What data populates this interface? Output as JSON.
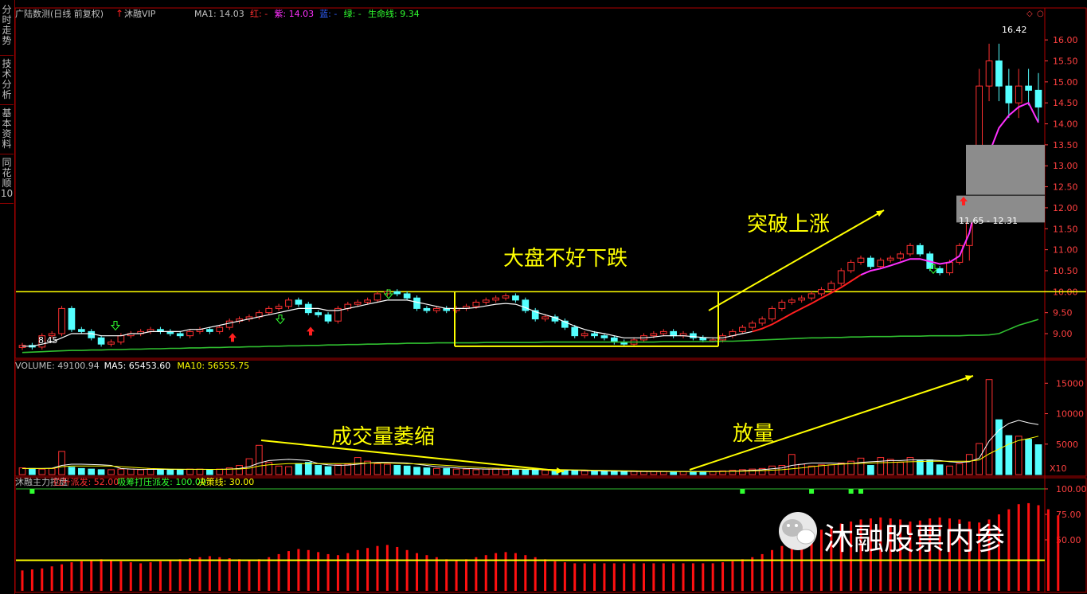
{
  "sidebar": {
    "tabs": [
      {
        "label": "分时走势",
        "active": false
      },
      {
        "label": "技术分析",
        "active": true
      },
      {
        "label": "基本资料",
        "active": false
      },
      {
        "label": "同花顺10",
        "active": false
      }
    ]
  },
  "header": {
    "title": "广陆数测(日线 前复权)",
    "badge": "沐融VIP",
    "legend": [
      {
        "text": "MA1: 14.03",
        "color": "#c0c0c0"
      },
      {
        "text": "红: -",
        "color": "#ff3030"
      },
      {
        "text": "紫: 14.03",
        "color": "#ff30ff"
      },
      {
        "text": "蓝: -",
        "color": "#3060ff"
      },
      {
        "text": "绿: -",
        "color": "#30ff30"
      },
      {
        "text": "生命线: 9.34",
        "color": "#30ff30"
      }
    ]
  },
  "volume_header": [
    {
      "text": "VOLUME: 49100.94",
      "color": "#c0c0c0"
    },
    {
      "text": "MA5: 65453.60",
      "color": "#ffffff"
    },
    {
      "text": "MA10: 56555.75",
      "color": "#ffff00"
    }
  ],
  "indicator_header": [
    {
      "text": "沐融主力控盘",
      "color": "#c0c0c0"
    },
    {
      "text": "拉升派发: 52.00",
      "color": "#ff3030"
    },
    {
      "text": "吸筹打压派发: 100.00",
      "color": "#30ff30"
    },
    {
      "text": "决策线: 30.00",
      "color": "#ffff00"
    }
  ],
  "annotations": {
    "weak_market": "大盘不好下跌",
    "breakout": "突破上涨",
    "volume_shrink": "成交量萎缩",
    "volume_expand": "放量"
  },
  "watermark": "沐融股票内参",
  "price_labels": {
    "high": "16.42",
    "low": "8.45",
    "range": "11.65 - 12.31"
  },
  "volume_unit": "X10",
  "colors": {
    "up": "#ff3030",
    "down": "#54ffff",
    "frame": "#b00000",
    "axis_text": "#ff4040",
    "yellow": "#ffff00"
  },
  "chart_data": [
    {
      "type": "candlestick",
      "title": "广陆数测(日线 前复权)",
      "ylim": [
        8.45,
        16.42
      ],
      "y_ticks": [
        9.0,
        9.5,
        10.0,
        10.5,
        11.0,
        11.5,
        12.0,
        12.5,
        13.0,
        13.5,
        14.0,
        14.5,
        15.0,
        15.5,
        16.0
      ],
      "closes": [
        8.72,
        8.68,
        8.95,
        9.0,
        9.6,
        9.1,
        9.05,
        8.9,
        8.75,
        8.8,
        8.95,
        9.0,
        9.05,
        9.1,
        9.05,
        9.0,
        8.95,
        9.05,
        9.1,
        9.05,
        9.15,
        9.3,
        9.35,
        9.4,
        9.5,
        9.6,
        9.65,
        9.8,
        9.7,
        9.5,
        9.45,
        9.3,
        9.6,
        9.7,
        9.75,
        9.8,
        9.95,
        10.0,
        9.95,
        9.85,
        9.6,
        9.55,
        9.6,
        9.55,
        9.6,
        9.65,
        9.75,
        9.8,
        9.85,
        9.9,
        9.8,
        9.55,
        9.35,
        9.4,
        9.3,
        9.15,
        8.95,
        9.0,
        8.95,
        8.9,
        8.8,
        8.75,
        8.85,
        8.95,
        9.0,
        9.05,
        8.95,
        9.0,
        8.9,
        8.85,
        8.85,
        8.95,
        9.05,
        9.15,
        9.25,
        9.35,
        9.6,
        9.75,
        9.8,
        9.85,
        9.95,
        10.05,
        10.2,
        10.5,
        10.7,
        10.8,
        10.6,
        10.75,
        10.8,
        10.9,
        11.1,
        10.9,
        10.55,
        10.45,
        10.7,
        11.1,
        12.3,
        14.9,
        15.5,
        14.9,
        14.5,
        14.9,
        14.8,
        14.4
      ],
      "ma_fast": [
        8.7,
        8.7,
        8.75,
        8.8,
        8.9,
        9.0,
        9.0,
        9.0,
        8.95,
        8.95,
        8.95,
        9.0,
        9.0,
        9.05,
        9.05,
        9.05,
        9.05,
        9.1,
        9.1,
        9.15,
        9.2,
        9.25,
        9.3,
        9.35,
        9.4,
        9.45,
        9.5,
        9.55,
        9.6,
        9.6,
        9.6,
        9.55,
        9.55,
        9.6,
        9.65,
        9.7,
        9.75,
        9.8,
        9.8,
        9.8,
        9.75,
        9.7,
        9.65,
        9.6,
        9.6,
        9.6,
        9.62,
        9.66,
        9.7,
        9.72,
        9.7,
        9.62,
        9.52,
        9.45,
        9.38,
        9.28,
        9.18,
        9.1,
        9.04,
        9.0,
        8.95,
        8.9,
        8.9,
        8.9,
        8.92,
        8.95,
        8.95,
        8.95,
        8.93,
        8.91,
        8.9,
        8.9,
        8.95,
        9.0,
        9.05,
        9.12,
        9.22,
        9.35,
        9.48,
        9.6,
        9.72,
        9.85,
        9.97,
        10.1,
        10.25,
        10.4,
        10.5,
        10.55,
        10.62,
        10.7,
        10.78,
        10.78,
        10.72,
        10.66,
        10.7,
        10.85,
        11.4,
        12.4,
        13.3,
        13.9,
        14.2,
        14.4,
        14.5,
        14.03
      ],
      "life_line": [
        8.55,
        8.56,
        8.57,
        8.58,
        8.59,
        8.6,
        8.6,
        8.61,
        8.61,
        8.62,
        8.62,
        8.63,
        8.63,
        8.64,
        8.64,
        8.65,
        8.65,
        8.66,
        8.66,
        8.67,
        8.67,
        8.68,
        8.68,
        8.69,
        8.69,
        8.7,
        8.7,
        8.71,
        8.71,
        8.72,
        8.72,
        8.73,
        8.73,
        8.74,
        8.74,
        8.75,
        8.75,
        8.76,
        8.76,
        8.77,
        8.77,
        8.77,
        8.78,
        8.78,
        8.78,
        8.78,
        8.78,
        8.79,
        8.79,
        8.79,
        8.79,
        8.79,
        8.79,
        8.8,
        8.8,
        8.8,
        8.8,
        8.8,
        8.8,
        8.8,
        8.8,
        8.8,
        8.8,
        8.8,
        8.8,
        8.81,
        8.81,
        8.81,
        8.81,
        8.81,
        8.81,
        8.82,
        8.82,
        8.83,
        8.84,
        8.85,
        8.86,
        8.87,
        8.88,
        8.89,
        8.9,
        8.9,
        8.91,
        8.91,
        8.92,
        8.92,
        8.93,
        8.93,
        8.93,
        8.94,
        8.94,
        8.94,
        8.95,
        8.95,
        8.95,
        8.95,
        8.96,
        8.96,
        8.97,
        9.0,
        9.1,
        9.2,
        9.27,
        9.34
      ]
    },
    {
      "type": "bar",
      "title": "VOLUME",
      "ylim": [
        0,
        17000
      ],
      "y_ticks": [
        5000,
        10000,
        15000
      ],
      "values": [
        1100,
        1000,
        900,
        1000,
        3800,
        1200,
        1000,
        900,
        800,
        800,
        900,
        900,
        800,
        900,
        800,
        800,
        800,
        900,
        900,
        800,
        900,
        1100,
        1500,
        2600,
        4800,
        2000,
        1400,
        1300,
        1800,
        2000,
        1500,
        1300,
        1600,
        1700,
        2800,
        2200,
        1800,
        1700,
        1500,
        1400,
        1200,
        1100,
        1000,
        1000,
        900,
        900,
        800,
        900,
        900,
        800,
        900,
        800,
        800,
        700,
        700,
        600,
        600,
        600,
        500,
        500,
        500,
        500,
        500,
        500,
        500,
        500,
        500,
        500,
        500,
        500,
        500,
        600,
        700,
        800,
        900,
        1000,
        1400,
        1500,
        3300,
        1700,
        1400,
        1600,
        1600,
        1900,
        2200,
        2700,
        1500,
        2800,
        2500,
        2000,
        2800,
        2300,
        2400,
        1600,
        1400,
        1800,
        3300,
        5100,
        15600,
        9000,
        6400,
        6300,
        5800,
        4900
      ],
      "ma5": [
        1000,
        1000,
        1000,
        1050,
        1500,
        1700,
        1700,
        1650,
        1600,
        1500,
        1000,
        900,
        850,
        850,
        850,
        850,
        850,
        850,
        850,
        850,
        850,
        900,
        1000,
        1300,
        1900,
        2300,
        2400,
        2500,
        2400,
        2300,
        1800,
        1600,
        1500,
        1550,
        1700,
        1900,
        2000,
        2000,
        1950,
        1900,
        1700,
        1500,
        1300,
        1200,
        1100,
        1000,
        950,
        900,
        880,
        860,
        860,
        850,
        830,
        800,
        770,
        730,
        700,
        660,
        620,
        580,
        550,
        530,
        520,
        510,
        500,
        500,
        500,
        500,
        500,
        500,
        500,
        520,
        560,
        620,
        700,
        800,
        950,
        1100,
        1500,
        1700,
        1900,
        1900,
        1900,
        1800,
        1800,
        2000,
        2100,
        2200,
        2300,
        2300,
        2400,
        2400,
        2400,
        2300,
        2100,
        2000,
        2100,
        2700,
        5500,
        7300,
        8400,
        8900,
        8500,
        8200
      ],
      "ma10": [
        1000,
        1000,
        1000,
        1000,
        1300,
        1400,
        1400,
        1400,
        1400,
        1400,
        1300,
        1200,
        1100,
        1000,
        950,
        900,
        880,
        860,
        860,
        850,
        850,
        870,
        920,
        1050,
        1400,
        1600,
        1700,
        1800,
        1800,
        1800,
        1800,
        1800,
        1800,
        1800,
        1850,
        1900,
        1900,
        1900,
        1850,
        1800,
        1750,
        1700,
        1600,
        1500,
        1400,
        1300,
        1200,
        1100,
        1050,
        1000,
        950,
        900,
        880,
        860,
        830,
        800,
        770,
        740,
        710,
        680,
        650,
        620,
        600,
        580,
        560,
        540,
        520,
        510,
        500,
        500,
        500,
        510,
        530,
        560,
        600,
        650,
        720,
        800,
        950,
        1100,
        1300,
        1450,
        1600,
        1700,
        1800,
        1850,
        1900,
        1950,
        2000,
        2050,
        2100,
        2150,
        2200,
        2200,
        2200,
        2200,
        2200,
        2400,
        3400,
        4200,
        5000,
        5600,
        5900,
        6300
      ]
    },
    {
      "type": "bar",
      "title": "沐融主力控盘",
      "ylim": [
        0,
        100
      ],
      "y_ticks": [
        50.0,
        75.0,
        100.0
      ],
      "values": [
        20,
        21,
        22,
        24,
        26,
        28,
        29,
        30,
        31,
        30,
        29,
        28,
        27,
        28,
        29,
        30,
        31,
        32,
        33,
        34,
        33,
        32,
        31,
        30,
        31,
        33,
        36,
        39,
        41,
        40,
        38,
        36,
        35,
        37,
        40,
        42,
        44,
        45,
        43,
        40,
        37,
        35,
        33,
        31,
        30,
        31,
        33,
        35,
        37,
        38,
        37,
        35,
        33,
        31,
        29,
        28,
        27,
        27,
        27,
        27,
        27,
        27,
        27,
        27,
        27,
        27,
        27,
        27,
        27,
        27,
        27,
        28,
        29,
        31,
        33,
        36,
        40,
        44,
        48,
        52,
        56,
        60,
        63,
        66,
        68,
        70,
        71,
        72,
        71,
        70,
        68,
        69,
        71,
        72,
        71,
        70,
        68,
        67,
        70,
        75,
        80,
        85,
        86,
        84,
        80,
        74
      ],
      "decision_line": 30.0,
      "green_markers": [
        1,
        73,
        80,
        84,
        85
      ]
    }
  ]
}
